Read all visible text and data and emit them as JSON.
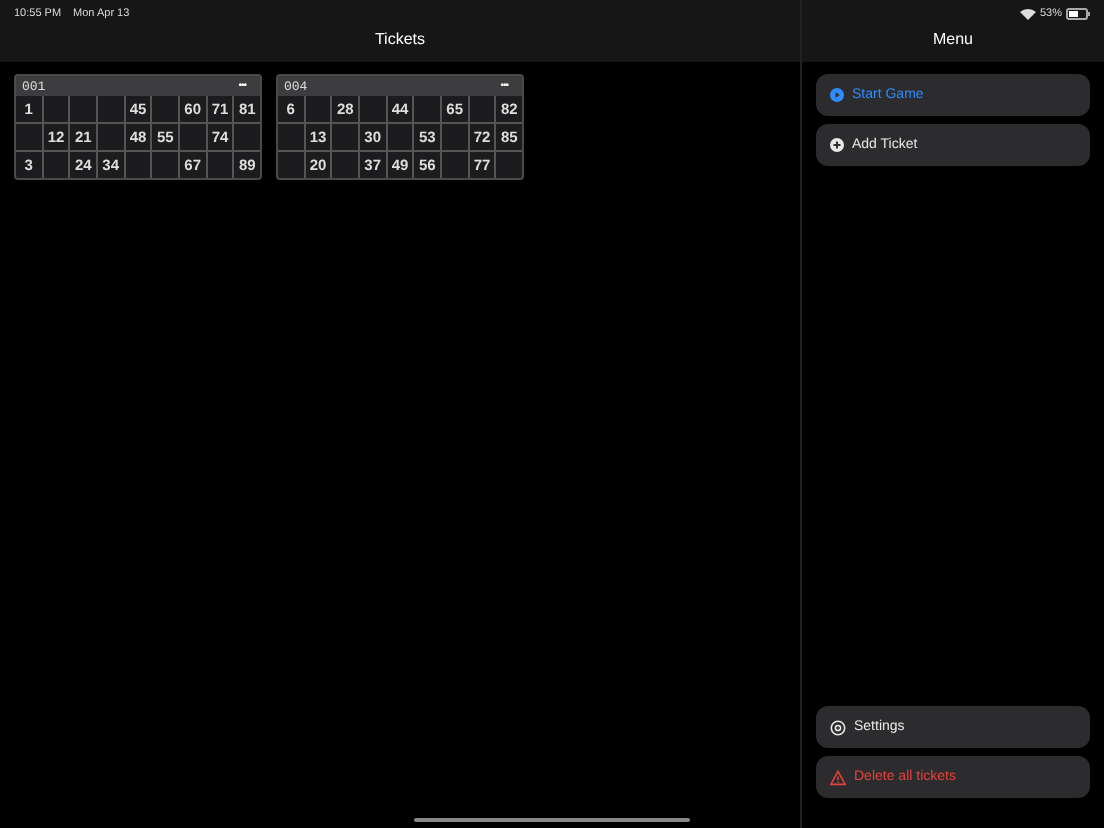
{
  "status_bar": {
    "time": "10:55 PM",
    "date": "Mon Apr 13",
    "battery": "53%"
  },
  "tickets_panel": {
    "title": "Tickets",
    "tickets": [
      {
        "id": "001",
        "more": "•••",
        "rows": [
          [
            "1",
            null,
            null,
            null,
            "45",
            null,
            "60",
            "71",
            "81"
          ],
          [
            null,
            "12",
            "21",
            null,
            "48",
            "55",
            null,
            "74",
            null
          ],
          [
            "3",
            null,
            "24",
            "34",
            null,
            null,
            "67",
            null,
            "89"
          ]
        ]
      },
      {
        "id": "004",
        "more": "•••",
        "rows": [
          [
            "6",
            null,
            "28",
            null,
            "44",
            null,
            "65",
            null,
            "82"
          ],
          [
            null,
            "13",
            null,
            "30",
            null,
            "53",
            null,
            "72",
            "85"
          ],
          [
            null,
            "20",
            null,
            "37",
            "49",
            "56",
            null,
            "77",
            null
          ]
        ]
      }
    ]
  },
  "menu_panel": {
    "title": "Menu",
    "top_items": [
      {
        "label": "Start Game",
        "kind": "start"
      },
      {
        "label": "Add Ticket",
        "kind": "add"
      }
    ],
    "bottom_items": [
      {
        "label": "Settings",
        "kind": "settings"
      },
      {
        "label": "Delete all tickets",
        "kind": "delete"
      }
    ]
  }
}
